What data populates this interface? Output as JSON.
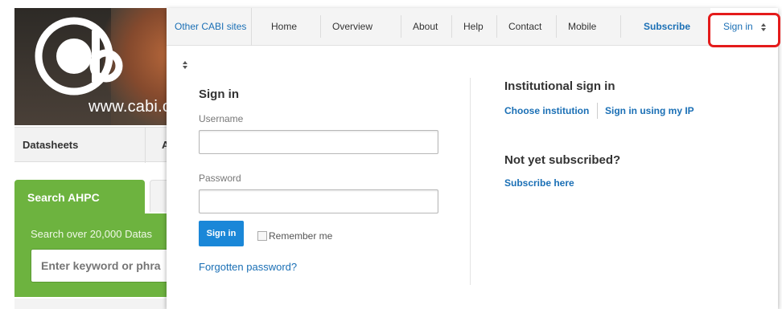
{
  "background": {
    "logo_url_text": "www.cabi.org",
    "tabs": [
      "Datasheets",
      "A"
    ],
    "search_tab_label": "Search AHPC",
    "search_description": "Search over 20,000 Datas",
    "search_placeholder": "Enter keyword or phra"
  },
  "topnav": {
    "other_sites": "Other CABI sites",
    "items": [
      "Home",
      "Overview",
      "About",
      "Help",
      "Contact",
      "Mobile"
    ],
    "subscribe": "Subscribe",
    "sign_in": "Sign in"
  },
  "signin": {
    "title": "Sign in",
    "username_label": "Username",
    "username_value": "",
    "password_label": "Password",
    "password_value": "",
    "submit": "Sign in",
    "remember_label": "Remember me",
    "remember_checked": false,
    "forgot": "Forgotten password?"
  },
  "institutional": {
    "title": "Institutional sign in",
    "choose": "Choose institution",
    "by_ip": "Sign in using my IP",
    "not_subscribed_title": "Not yet subscribed?",
    "subscribe_here": "Subscribe here"
  },
  "colors": {
    "link_blue": "#1a6fb5",
    "button_blue": "#1a87d8",
    "search_green": "#6db33f",
    "highlight_red": "#e41b1b"
  }
}
